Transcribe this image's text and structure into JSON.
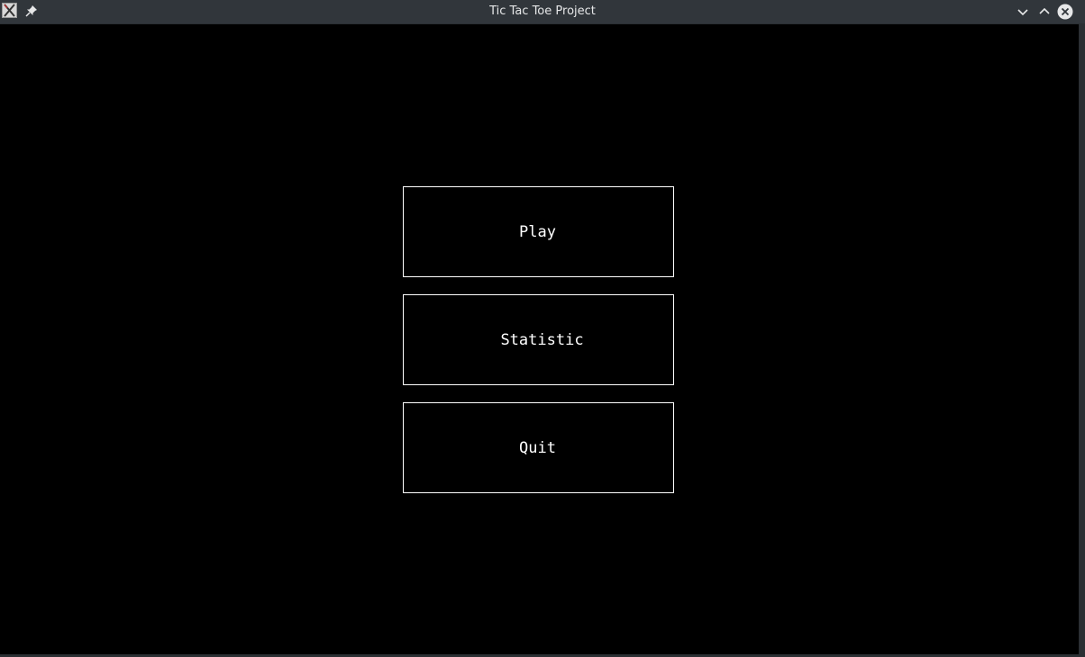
{
  "window": {
    "title": "Tic Tac Toe Project",
    "app_icon": "x11-app-icon",
    "pin_icon": "pin-icon",
    "minimize_icon": "chevron-down-icon",
    "maximize_icon": "chevron-up-icon",
    "close_icon": "close-icon"
  },
  "menu": {
    "play_label": "Play",
    "statistic_label": "Statistic",
    "quit_label": "Quit"
  },
  "colors": {
    "background": "#000000",
    "button_border": "#ffffff",
    "button_text": "#ffffff",
    "titlebar": "#31363b"
  }
}
